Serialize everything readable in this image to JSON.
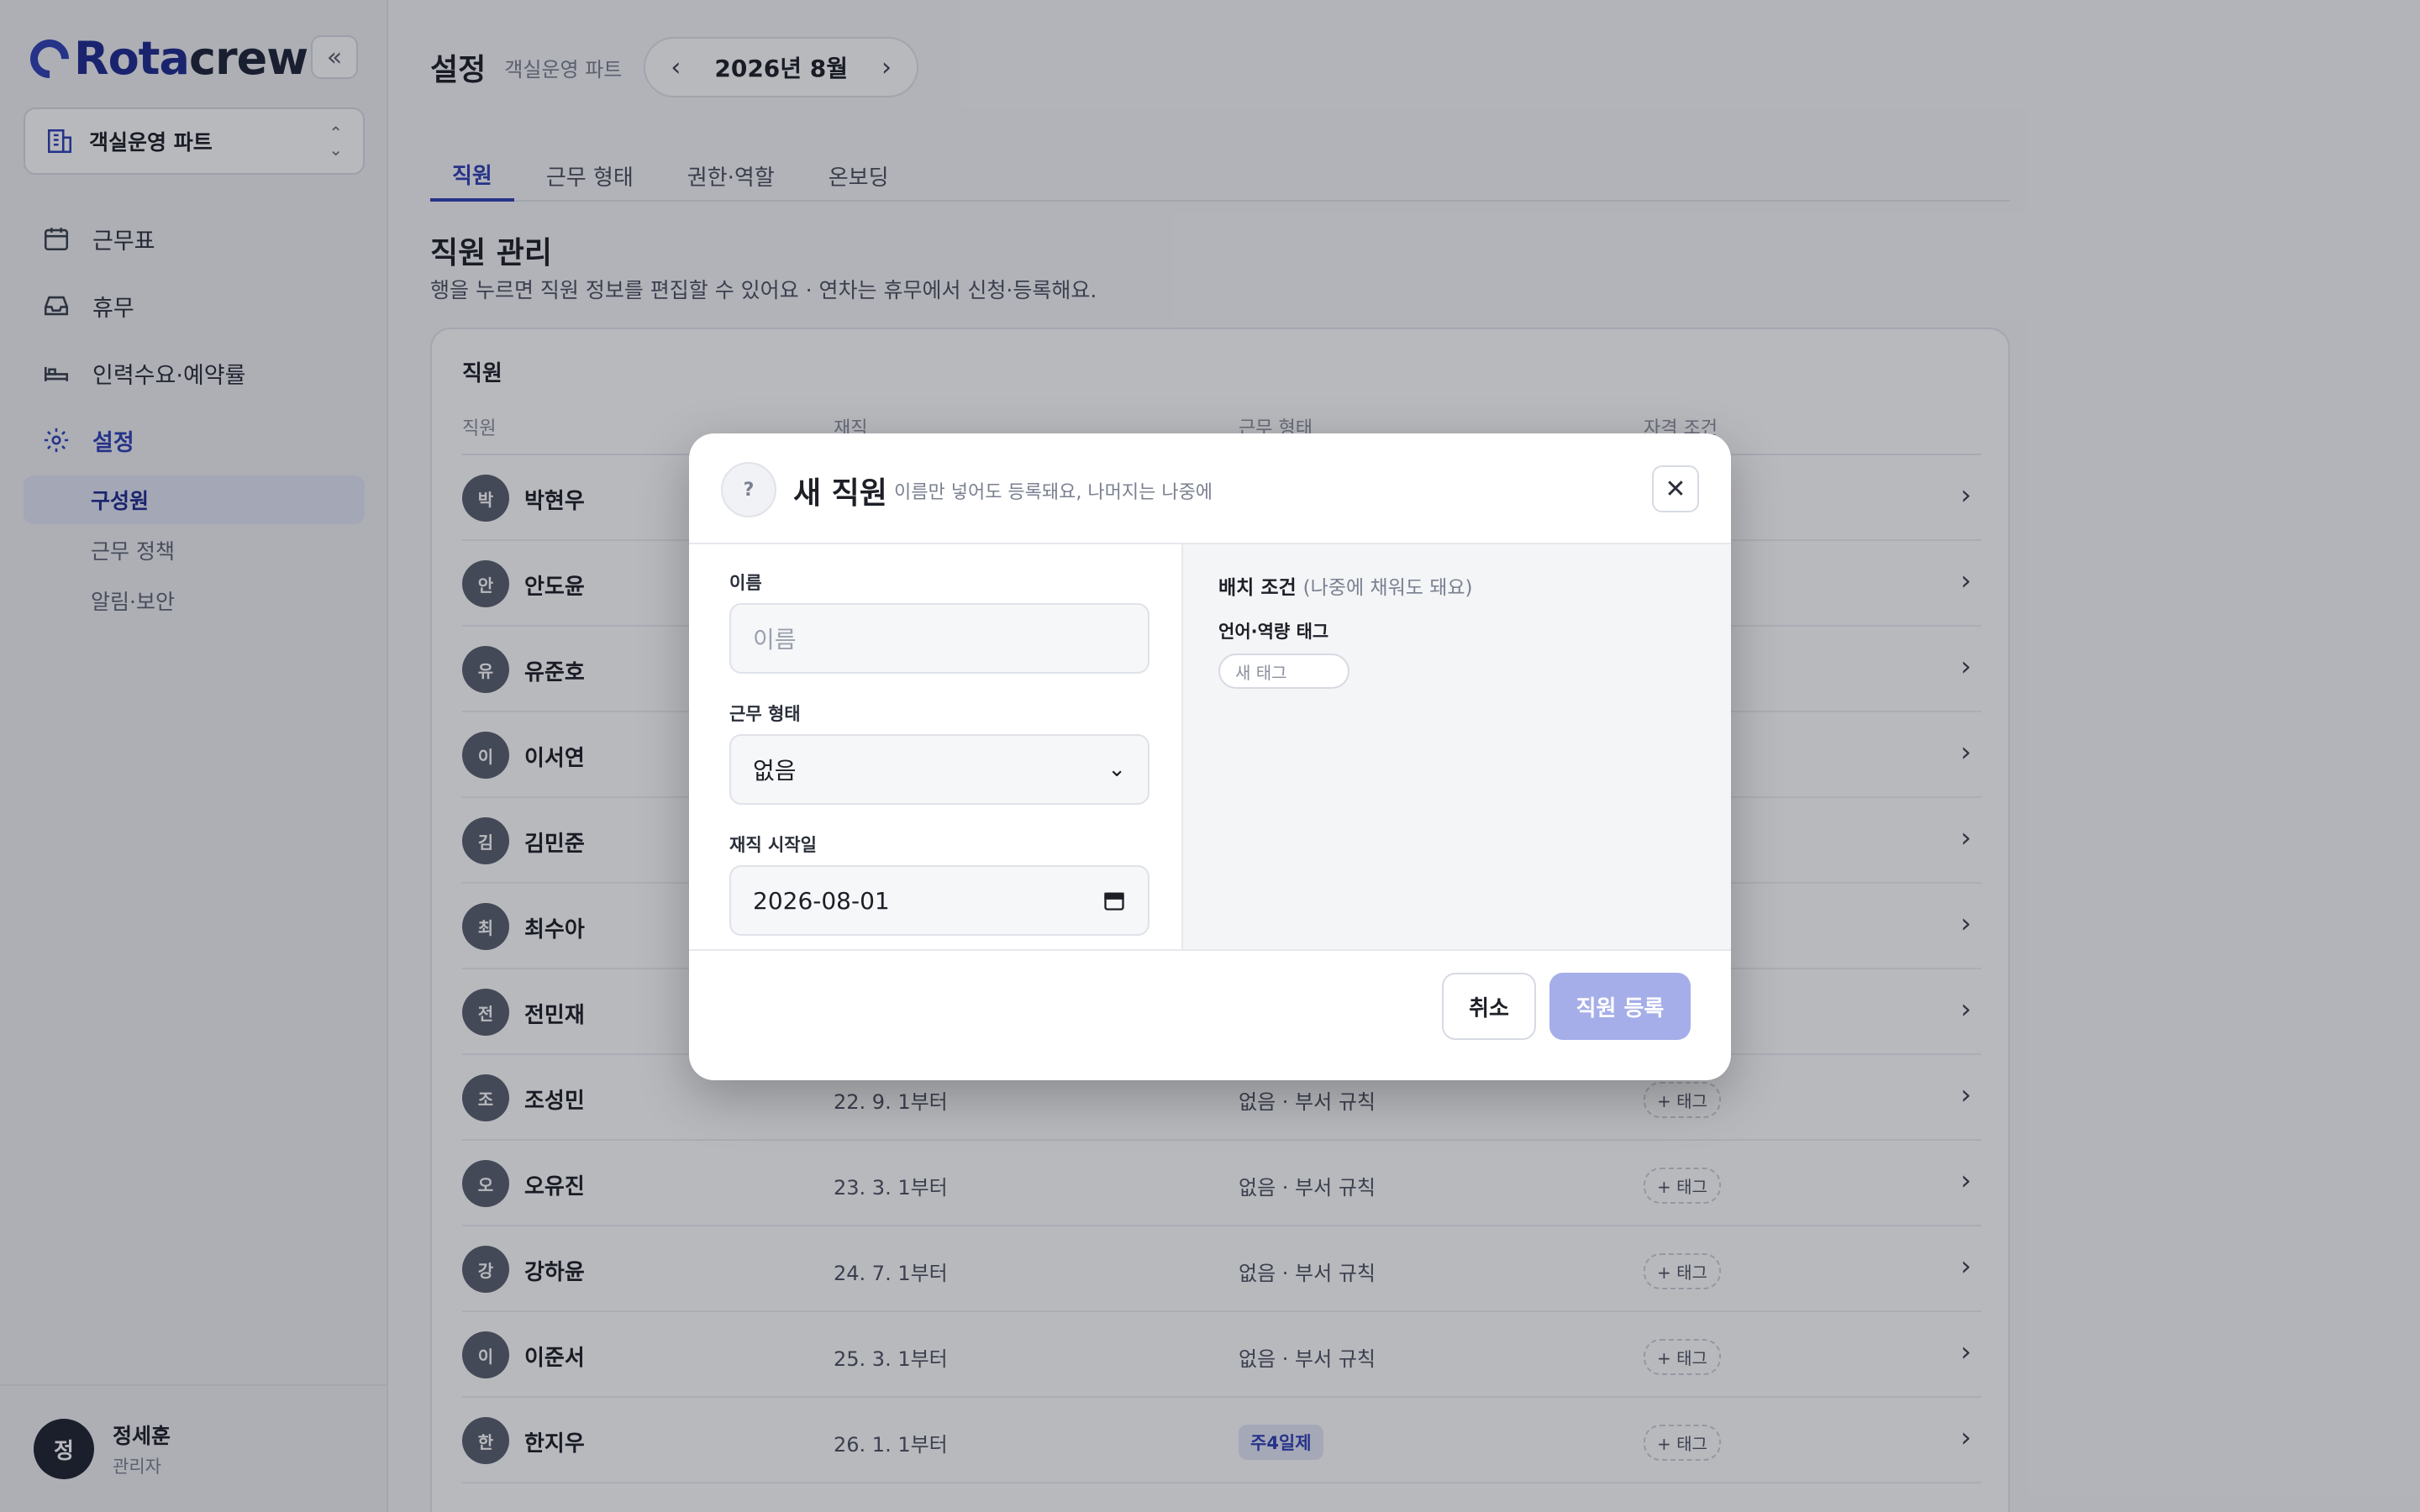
{
  "brand": {
    "logo_left": "Rota",
    "logo_right": "crew"
  },
  "sidebar": {
    "team": "객실운영 파트",
    "collapse_icon": "«",
    "items": [
      {
        "label": "근무표",
        "icon": "calendar-icon"
      },
      {
        "label": "휴무",
        "icon": "inbox-icon"
      },
      {
        "label": "인력수요·예약률",
        "icon": "bed-icon"
      },
      {
        "label": "설정",
        "icon": "gear-icon"
      }
    ],
    "subitems": [
      "구성원",
      "근무 정책",
      "알림·보안"
    ],
    "user": {
      "initial": "정",
      "name": "정세훈",
      "role": "관리자"
    }
  },
  "header": {
    "title": "설정",
    "subtitle": "객실운영 파트",
    "month": "2026년 8월"
  },
  "tabs": [
    "직원",
    "근무 형태",
    "권한·역할",
    "온보딩"
  ],
  "section": {
    "title": "직원 관리",
    "desc": "행을 누르면 직원 정보를 편집할 수 있어요 · 연차는 휴무에서 신청·등록해요."
  },
  "table": {
    "title": "직원",
    "columns": [
      "직원",
      "재직",
      "근무 형태",
      "자격 조건"
    ],
    "rows": [
      {
        "initial": "박",
        "name": "박현우",
        "tenure": "",
        "worktype": "",
        "tag": ""
      },
      {
        "initial": "안",
        "name": "안도윤",
        "tenure": "",
        "worktype": "",
        "tag": ""
      },
      {
        "initial": "유",
        "name": "유준호",
        "tenure": "",
        "worktype": "",
        "tag": ""
      },
      {
        "initial": "이",
        "name": "이서연",
        "tenure": "",
        "worktype": "",
        "tag": ""
      },
      {
        "initial": "김",
        "name": "김민준",
        "tenure": "",
        "worktype": "",
        "tag": ""
      },
      {
        "initial": "최",
        "name": "최수아",
        "tenure": "",
        "worktype": "",
        "tag": ""
      },
      {
        "initial": "전",
        "name": "전민재",
        "tenure": "",
        "worktype": "",
        "tag": ""
      },
      {
        "initial": "조",
        "name": "조성민",
        "tenure": "22. 9. 1부터",
        "worktype": "없음 · 부서 규칙",
        "tag": "+ 태그"
      },
      {
        "initial": "오",
        "name": "오유진",
        "tenure": "23. 3. 1부터",
        "worktype": "없음 · 부서 규칙",
        "tag": "+ 태그"
      },
      {
        "initial": "강",
        "name": "강하윤",
        "tenure": "24. 7. 1부터",
        "worktype": "없음 · 부서 규칙",
        "tag": "+ 태그"
      },
      {
        "initial": "이",
        "name": "이준서",
        "tenure": "25. 3. 1부터",
        "worktype": "없음 · 부서 규칙",
        "tag": "+ 태그"
      },
      {
        "initial": "한",
        "name": "한지우",
        "tenure": "26. 1. 1부터",
        "worktype": "주4일제",
        "tag": "+ 태그"
      }
    ]
  },
  "modal": {
    "help": "?",
    "title": "새 직원",
    "subtitle": "이름만 넣어도 등록돼요, 나머지는 나중에",
    "name_label": "이름",
    "name_placeholder": "이름",
    "worktype_label": "근무 형태",
    "worktype_value": "없음",
    "start_label": "재직 시작일",
    "start_value": "2026-08-01",
    "right_title": "배치 조건",
    "right_hint": "(나중에 채워도 돼요)",
    "tags_label": "언어·역량 태그",
    "tags_placeholder": "새 태그",
    "cancel": "취소",
    "submit": "직원 등록"
  },
  "colors": {
    "accent": "#2f3fb5",
    "submit_disabled": "#a5aee8"
  }
}
